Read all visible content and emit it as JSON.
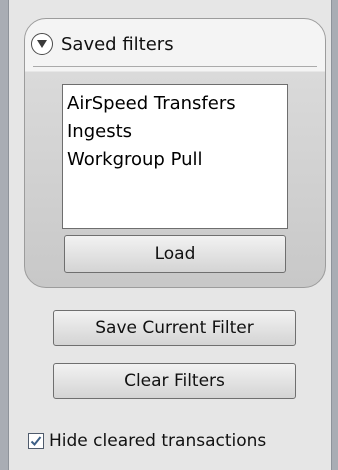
{
  "saved_filters": {
    "title": "Saved filters",
    "items": [
      {
        "label": "AirSpeed Transfers"
      },
      {
        "label": "Ingests"
      },
      {
        "label": "Workgroup Pull"
      }
    ],
    "load_label": "Load",
    "collapse_icon": "chevron-down-icon"
  },
  "actions": {
    "save_label": "Save Current Filter",
    "clear_label": "Clear Filters"
  },
  "options": {
    "hide_cleared_label": "Hide cleared transactions",
    "hide_cleared_checked": true,
    "check_icon": "check-icon"
  },
  "colors": {
    "background": "#e6e6e6",
    "checkmark": "#3d5f86"
  }
}
